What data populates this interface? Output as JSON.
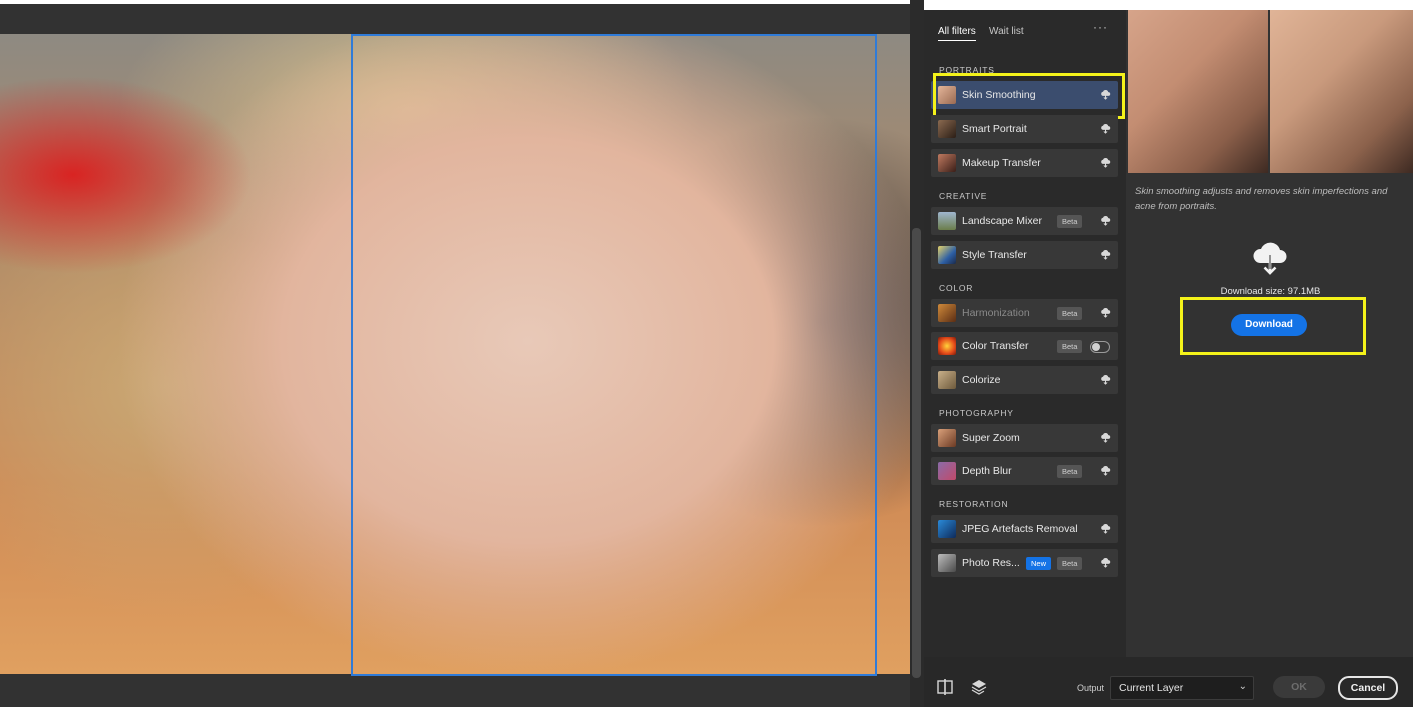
{
  "tabs": [
    {
      "label": "All filters",
      "active": true
    },
    {
      "label": "Wait list",
      "active": false
    }
  ],
  "more_label": "···",
  "sections": {
    "portraits": "PORTRAITS",
    "creative": "CREATIVE",
    "color": "COLOR",
    "photography": "PHOTOGRAPHY",
    "restoration": "RESTORATION"
  },
  "filters": {
    "skin_smoothing": {
      "label": "Skin Smoothing"
    },
    "smart_portrait": {
      "label": "Smart Portrait"
    },
    "makeup_transfer": {
      "label": "Makeup Transfer"
    },
    "landscape_mixer": {
      "label": "Landscape Mixer",
      "badge": "Beta"
    },
    "style_transfer": {
      "label": "Style Transfer"
    },
    "harmonization": {
      "label": "Harmonization",
      "badge": "Beta"
    },
    "color_transfer": {
      "label": "Color Transfer",
      "badge": "Beta"
    },
    "colorize": {
      "label": "Colorize"
    },
    "super_zoom": {
      "label": "Super Zoom"
    },
    "depth_blur": {
      "label": "Depth Blur",
      "badge": "Beta"
    },
    "jpeg_artefacts": {
      "label": "JPEG Artefacts Removal"
    },
    "photo_restoration": {
      "label": "Photo Res...",
      "badge_new": "New",
      "badge": "Beta"
    }
  },
  "info": {
    "description": "Skin smoothing adjusts and removes skin imperfections and acne from portraits.",
    "download_size": "Download size: 97.1MB",
    "download_label": "Download"
  },
  "bottom": {
    "output_label": "Output",
    "output_value": "Current Layer",
    "ok_label": "OK",
    "cancel_label": "Cancel"
  },
  "colors": {
    "accent": "#1473e6",
    "highlight": "#f4f21a",
    "selected_row": "#3b4d6e"
  }
}
